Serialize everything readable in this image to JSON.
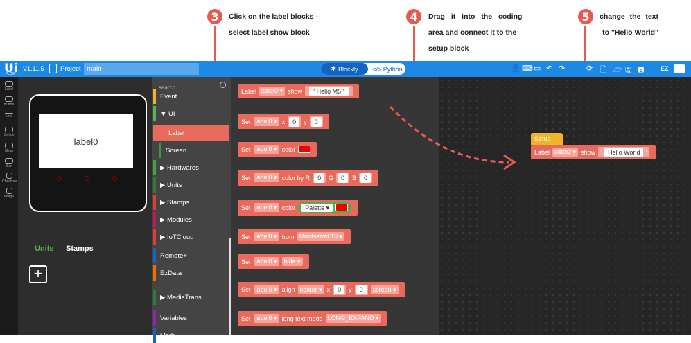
{
  "annotations": [
    {
      "number": "3",
      "text_line1": "Click on the label blocks -",
      "text_line2": "select label show block"
    },
    {
      "number": "4",
      "text_line1": "Drag it into the coding",
      "text_line2": "area and connect it to the",
      "text_line3": "setup block"
    },
    {
      "number": "5",
      "text_line1": "change the text",
      "text_line2": "to \"Hello World\""
    }
  ],
  "topbar": {
    "logo": "Ui",
    "logo_sub": "FLOW",
    "version": "V1.11.5",
    "project_label": "Project",
    "project_name": "main",
    "mode_blockly": "Blockly",
    "mode_python": "</> Python",
    "right_icons": [
      "user-icon",
      "keyboard-icon",
      "device-icon",
      "undo-icon",
      "redo-icon",
      "ota-icon",
      "new-file-icon",
      "open-folder-icon",
      "save-icon",
      "save-as-icon",
      "ezdata-icon"
    ],
    "ez_label": "EZ"
  },
  "toolstrip": [
    "Label",
    "Button",
    "Line",
    "Switch",
    "Slider",
    "Bar",
    "Checkbox",
    "Image"
  ],
  "device": {
    "screen_text": "label0"
  },
  "bottom_tabs": {
    "units": "Units",
    "stamps": "Stamps",
    "add": "+"
  },
  "search": {
    "placeholder": "search"
  },
  "categories": [
    {
      "label": "Event",
      "color": "#f0b429"
    },
    {
      "label": "▼ UI",
      "color": "#5ab24e"
    },
    {
      "label": "Label",
      "color": "#e86a5c",
      "selected": true
    },
    {
      "label": "Screen",
      "color": "#3a9a3a"
    },
    {
      "label": "▶ Hardwares",
      "color": "#43a047"
    },
    {
      "label": "▶ Units",
      "color": "#2e7d32"
    },
    {
      "label": "▶ Stamps",
      "color": "#e53935"
    },
    {
      "label": "▶ Modules",
      "color": "#c2185b"
    },
    {
      "label": "▶ IoTCloud",
      "color": "#e53935"
    },
    {
      "label": "Remote+",
      "color": "#1565c0"
    },
    {
      "label": "EzData",
      "color": "#ef6c00"
    },
    {
      "label": "▶ MediaTrans",
      "color": "#2e7d32"
    },
    {
      "label": "Variables",
      "color": "#8e24aa"
    },
    {
      "label": "Math",
      "color": "#1565c0"
    }
  ],
  "flyout_blocks": [
    {
      "parts": [
        "Label",
        "label0 ▾",
        "show",
        "“ Hello M5 ”"
      ]
    },
    {
      "parts": [
        "Set",
        "label0 ▾",
        "x",
        "0",
        "y",
        "0"
      ]
    },
    {
      "parts": [
        "Set",
        "label0 ▾",
        "color"
      ]
    },
    {
      "parts": [
        "Set",
        "label0 ▾",
        "color by R",
        "0",
        "G",
        "0",
        "B",
        "0"
      ]
    },
    {
      "parts": [
        "Set",
        "label0 ▾",
        "color",
        "Palette ▾"
      ]
    },
    {
      "parts": [
        "Set",
        "label0 ▾",
        "from",
        "Montserrat 10 ▾"
      ]
    },
    {
      "parts": [
        "Set",
        "label0 ▾",
        "hide ▾"
      ]
    },
    {
      "parts": [
        "Set",
        "label0 ▾",
        "align",
        "center ▾",
        "x",
        "0",
        "y",
        "0",
        "screen ▾"
      ]
    },
    {
      "parts": [
        "Set",
        "label0 ▾",
        "long text mode",
        "LONG_EXPAND ▾"
      ]
    }
  ],
  "workspace": {
    "setup_label": "Setup",
    "block_label": "Label",
    "block_target": "label0 ▾",
    "block_show": "show",
    "block_text": "Hello World"
  },
  "colors": {
    "accent": "#1e88e5",
    "block": "#e86a5c",
    "setup": "#f0b429",
    "annotation": "#e85a4f"
  }
}
